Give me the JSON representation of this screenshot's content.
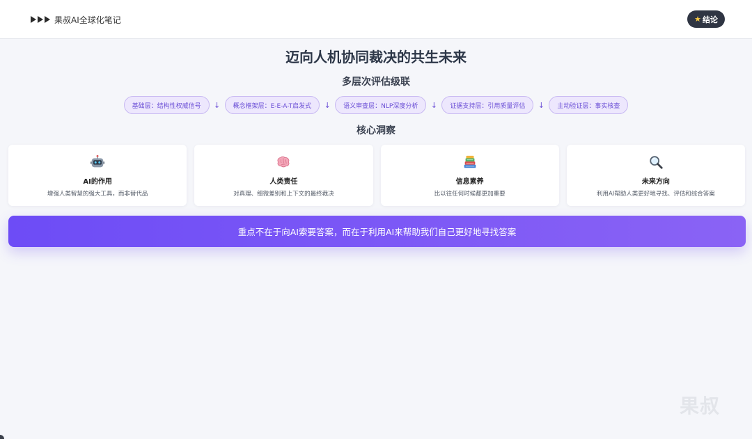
{
  "header": {
    "brand_name": "果叔AI全球化笔记",
    "conclusion_label": "结论",
    "play_icon": "play-triangle-icon",
    "star_icon": "star-icon"
  },
  "main": {
    "title": "迈向人机协同裁决的共生未来",
    "layers_title": "多层次评估级联",
    "layers": [
      {
        "label": "基础层：结构性权威信号"
      },
      {
        "label": "概念框架层：E-E-A-T启发式"
      },
      {
        "label": "语义审查层：NLP深度分析"
      },
      {
        "label": "证据支持层：引用质量评估"
      },
      {
        "label": "主动验证层：事实核查"
      }
    ],
    "arrow_glyph": "↓",
    "insights_title": "核心洞察",
    "insights": [
      {
        "icon": "robot-icon",
        "title": "AI的作用",
        "desc": "增强人类智慧的强大工具，而非替代品"
      },
      {
        "icon": "brain-icon",
        "title": "人类责任",
        "desc": "对真理、细微差别和上下文的最终裁决"
      },
      {
        "icon": "books-icon",
        "title": "信息素养",
        "desc": "比以往任何时候都更加重要"
      },
      {
        "icon": "magnifier-icon",
        "title": "未来方向",
        "desc": "利用AI帮助人类更好地寻找、评估和综合答案"
      }
    ],
    "banner_text": "重点不在于向AI索要答案，而在于利用AI来帮助我们自己更好地寻找答案"
  },
  "watermark": "果叔",
  "colors": {
    "accent": "#6d4cf6",
    "chip_bg": "#ede7fd",
    "chip_text": "#6b4fd6",
    "button_bg": "#2f3543"
  }
}
